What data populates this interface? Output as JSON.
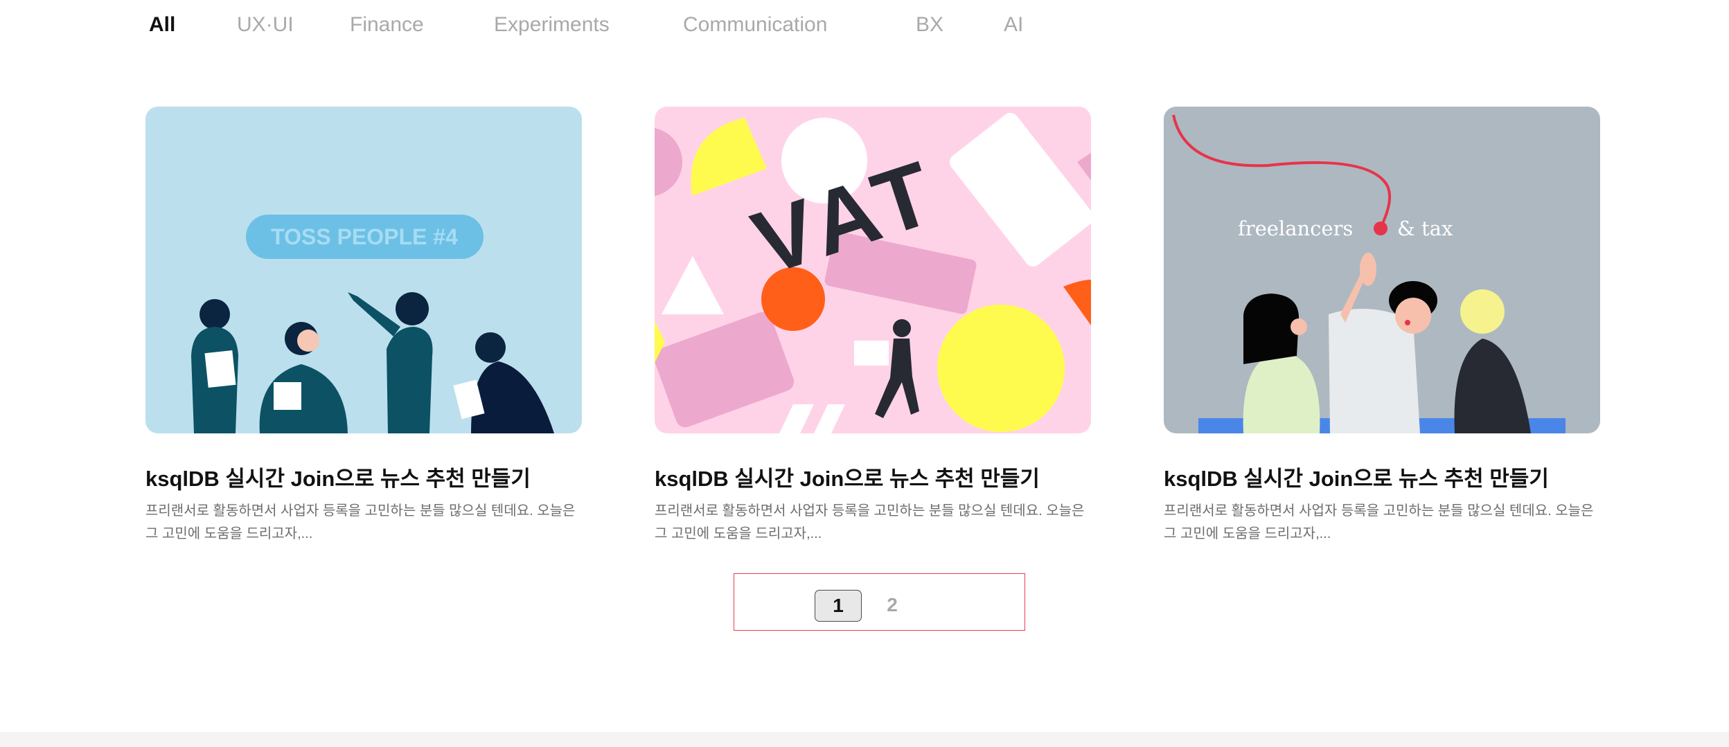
{
  "tabs": [
    "All",
    "UX·UI",
    "Finance",
    "Experiments",
    "Communication",
    "BX",
    "AI"
  ],
  "active_tab": "All",
  "cards": [
    {
      "image_text": "TOSS PEOPLE #4",
      "title": "ksqlDB 실시간 Join으로 뉴스 추천 만들기",
      "description": "프리랜서로 활동하면서 사업자 등록을 고민하는 분들 많으실 텐데요. 오늘은 그 고민에 도움을 드리고자,..."
    },
    {
      "image_text": "VAT",
      "title": "ksqlDB 실시간 Join으로 뉴스 추천 만들기",
      "description": "프리랜서로 활동하면서 사업자 등록을 고민하는 분들 많으실 텐데요. 오늘은 그 고민에 도움을 드리고자,..."
    },
    {
      "image_text_left": "freelancers",
      "image_text_right": "& tax",
      "title": "ksqlDB 실시간 Join으로 뉴스 추천 만들기",
      "description": "프리랜서로 활동하면서 사업자 등록을 고민하는 분들 많으실 텐데요. 오늘은 그 고민에 도움을 드리고자,..."
    }
  ],
  "pagination": {
    "current": "1",
    "other": "2"
  },
  "colors": {
    "thumb1_bg": "#bcdfed",
    "thumb2_bg": "#ffd3e7",
    "thumb3_bg": "#aeb8c1",
    "pagination_border": "#e0404e",
    "active_tab": "#111111",
    "inactive_tab": "#a9a9a9"
  }
}
